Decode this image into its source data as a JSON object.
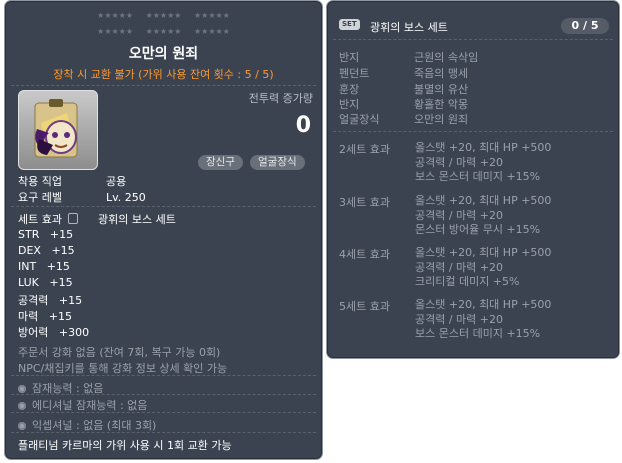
{
  "item": {
    "stars_row1": [
      "★★★★★",
      "★★★★★",
      "★★★★★"
    ],
    "stars_row2": [
      "★★★★★",
      "★★★★★",
      "★★★★★"
    ],
    "name": "오만의 원죄",
    "trade_note": "장착 시 교환 불가 (가위 사용 잔여 횟수 : 5 / 5)",
    "icon": "cursed-mask-icon",
    "combat_power_label": "전투력 증가량",
    "combat_power_value": "0",
    "tags": [
      "장신구",
      "얼굴장식"
    ],
    "job_label": "착용 직업",
    "job_value": "공용",
    "level_label": "요구 레벨",
    "level_value": "Lv. 250",
    "set_label": "세트 효과",
    "set_value": "광휘의 보스 세트",
    "stats": [
      {
        "name": "STR",
        "value": "+15"
      },
      {
        "name": "DEX",
        "value": "+15"
      },
      {
        "name": "INT",
        "value": "+15"
      },
      {
        "name": "LUK",
        "value": "+15"
      },
      {
        "name": "공격력",
        "value": "+15"
      },
      {
        "name": "마력",
        "value": "+15"
      },
      {
        "name": "방어력",
        "value": "+300"
      }
    ],
    "scroll_note": "주문서 강화 없음 (잔여 7회, 복구 가능 0회)",
    "npc_note": "NPC/채집키를 통해 강화 정보 상세 확인 가능",
    "potential": "잠재능력 : 없음",
    "additional_potential": "에디셔널 잠재능력 : 없음",
    "exceptional": "익셉셔널 : 없음 (최대 3회)",
    "platinum_note": "플래티넘 카르마의 가위 사용 시 1회 교환 가능"
  },
  "set_panel": {
    "badge": "SET",
    "title": "광휘의 보스 세트",
    "count": "0 / 5",
    "items": [
      {
        "slot": "반지",
        "name": "근원의 속삭임"
      },
      {
        "slot": "펜던트",
        "name": "죽음의 맹세"
      },
      {
        "slot": "훈장",
        "name": "불멸의 유산"
      },
      {
        "slot": "반지",
        "name": "황홀한 악몽"
      },
      {
        "slot": "얼굴장식",
        "name": "오만의 원죄"
      }
    ],
    "effects": [
      {
        "label": "2세트 효과",
        "lines": [
          "올스탯 +20, 최대 HP +500",
          "공격력 / 마력 +20",
          "보스 몬스터 데미지 +15%"
        ]
      },
      {
        "label": "3세트 효과",
        "lines": [
          "올스탯 +20, 최대 HP +500",
          "공격력 / 마력 +20",
          "몬스터 방어율 무시 +15%"
        ]
      },
      {
        "label": "4세트 효과",
        "lines": [
          "올스탯 +20, 최대 HP +500",
          "공격력 / 마력 +20",
          "크리티컬 데미지 +5%"
        ]
      },
      {
        "label": "5세트 효과",
        "lines": [
          "올스탯 +20, 최대 HP +500",
          "공격력 / 마력 +20",
          "보스 몬스터 데미지 +15%"
        ]
      }
    ]
  }
}
